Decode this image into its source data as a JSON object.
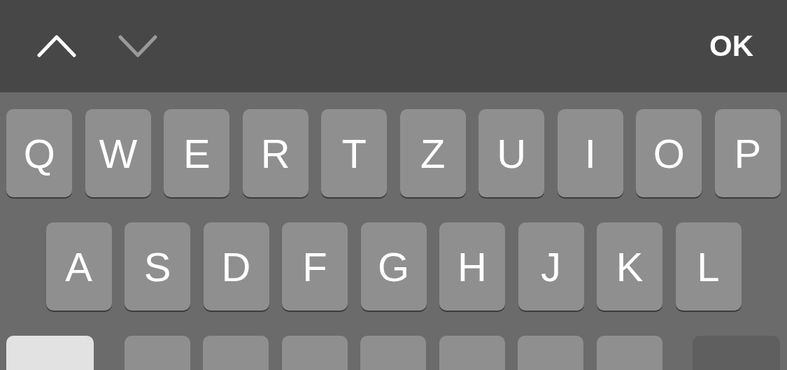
{
  "toolbar": {
    "nav": [
      {
        "kind": "up",
        "disabled": false
      },
      {
        "kind": "down",
        "disabled": true
      }
    ],
    "done": "OK"
  },
  "rows": [
    {
      "keys": [
        {
          "kind": "letter",
          "label": "Q"
        },
        {
          "kind": "letter",
          "label": "W"
        },
        {
          "kind": "letter",
          "label": "E"
        },
        {
          "kind": "letter",
          "label": "R"
        },
        {
          "kind": "letter",
          "label": "T"
        },
        {
          "kind": "letter",
          "label": "Z"
        },
        {
          "kind": "letter",
          "label": "U"
        },
        {
          "kind": "letter",
          "label": "I"
        },
        {
          "kind": "letter",
          "label": "O"
        },
        {
          "kind": "letter",
          "label": "P"
        }
      ]
    },
    {
      "keys": [
        {
          "kind": "letter",
          "label": "A"
        },
        {
          "kind": "letter",
          "label": "S"
        },
        {
          "kind": "letter",
          "label": "D"
        },
        {
          "kind": "letter",
          "label": "F"
        },
        {
          "kind": "letter",
          "label": "G"
        },
        {
          "kind": "letter",
          "label": "H"
        },
        {
          "kind": "letter",
          "label": "J"
        },
        {
          "kind": "letter",
          "label": "K"
        },
        {
          "kind": "letter",
          "label": "L"
        }
      ]
    },
    {
      "keys": [
        {
          "kind": "shift",
          "on": true
        },
        {
          "kind": "letter"
        },
        {
          "kind": "letter"
        },
        {
          "kind": "letter"
        },
        {
          "kind": "letter"
        },
        {
          "kind": "letter"
        },
        {
          "kind": "letter"
        },
        {
          "kind": "letter"
        },
        {
          "kind": "delete"
        }
      ]
    }
  ]
}
